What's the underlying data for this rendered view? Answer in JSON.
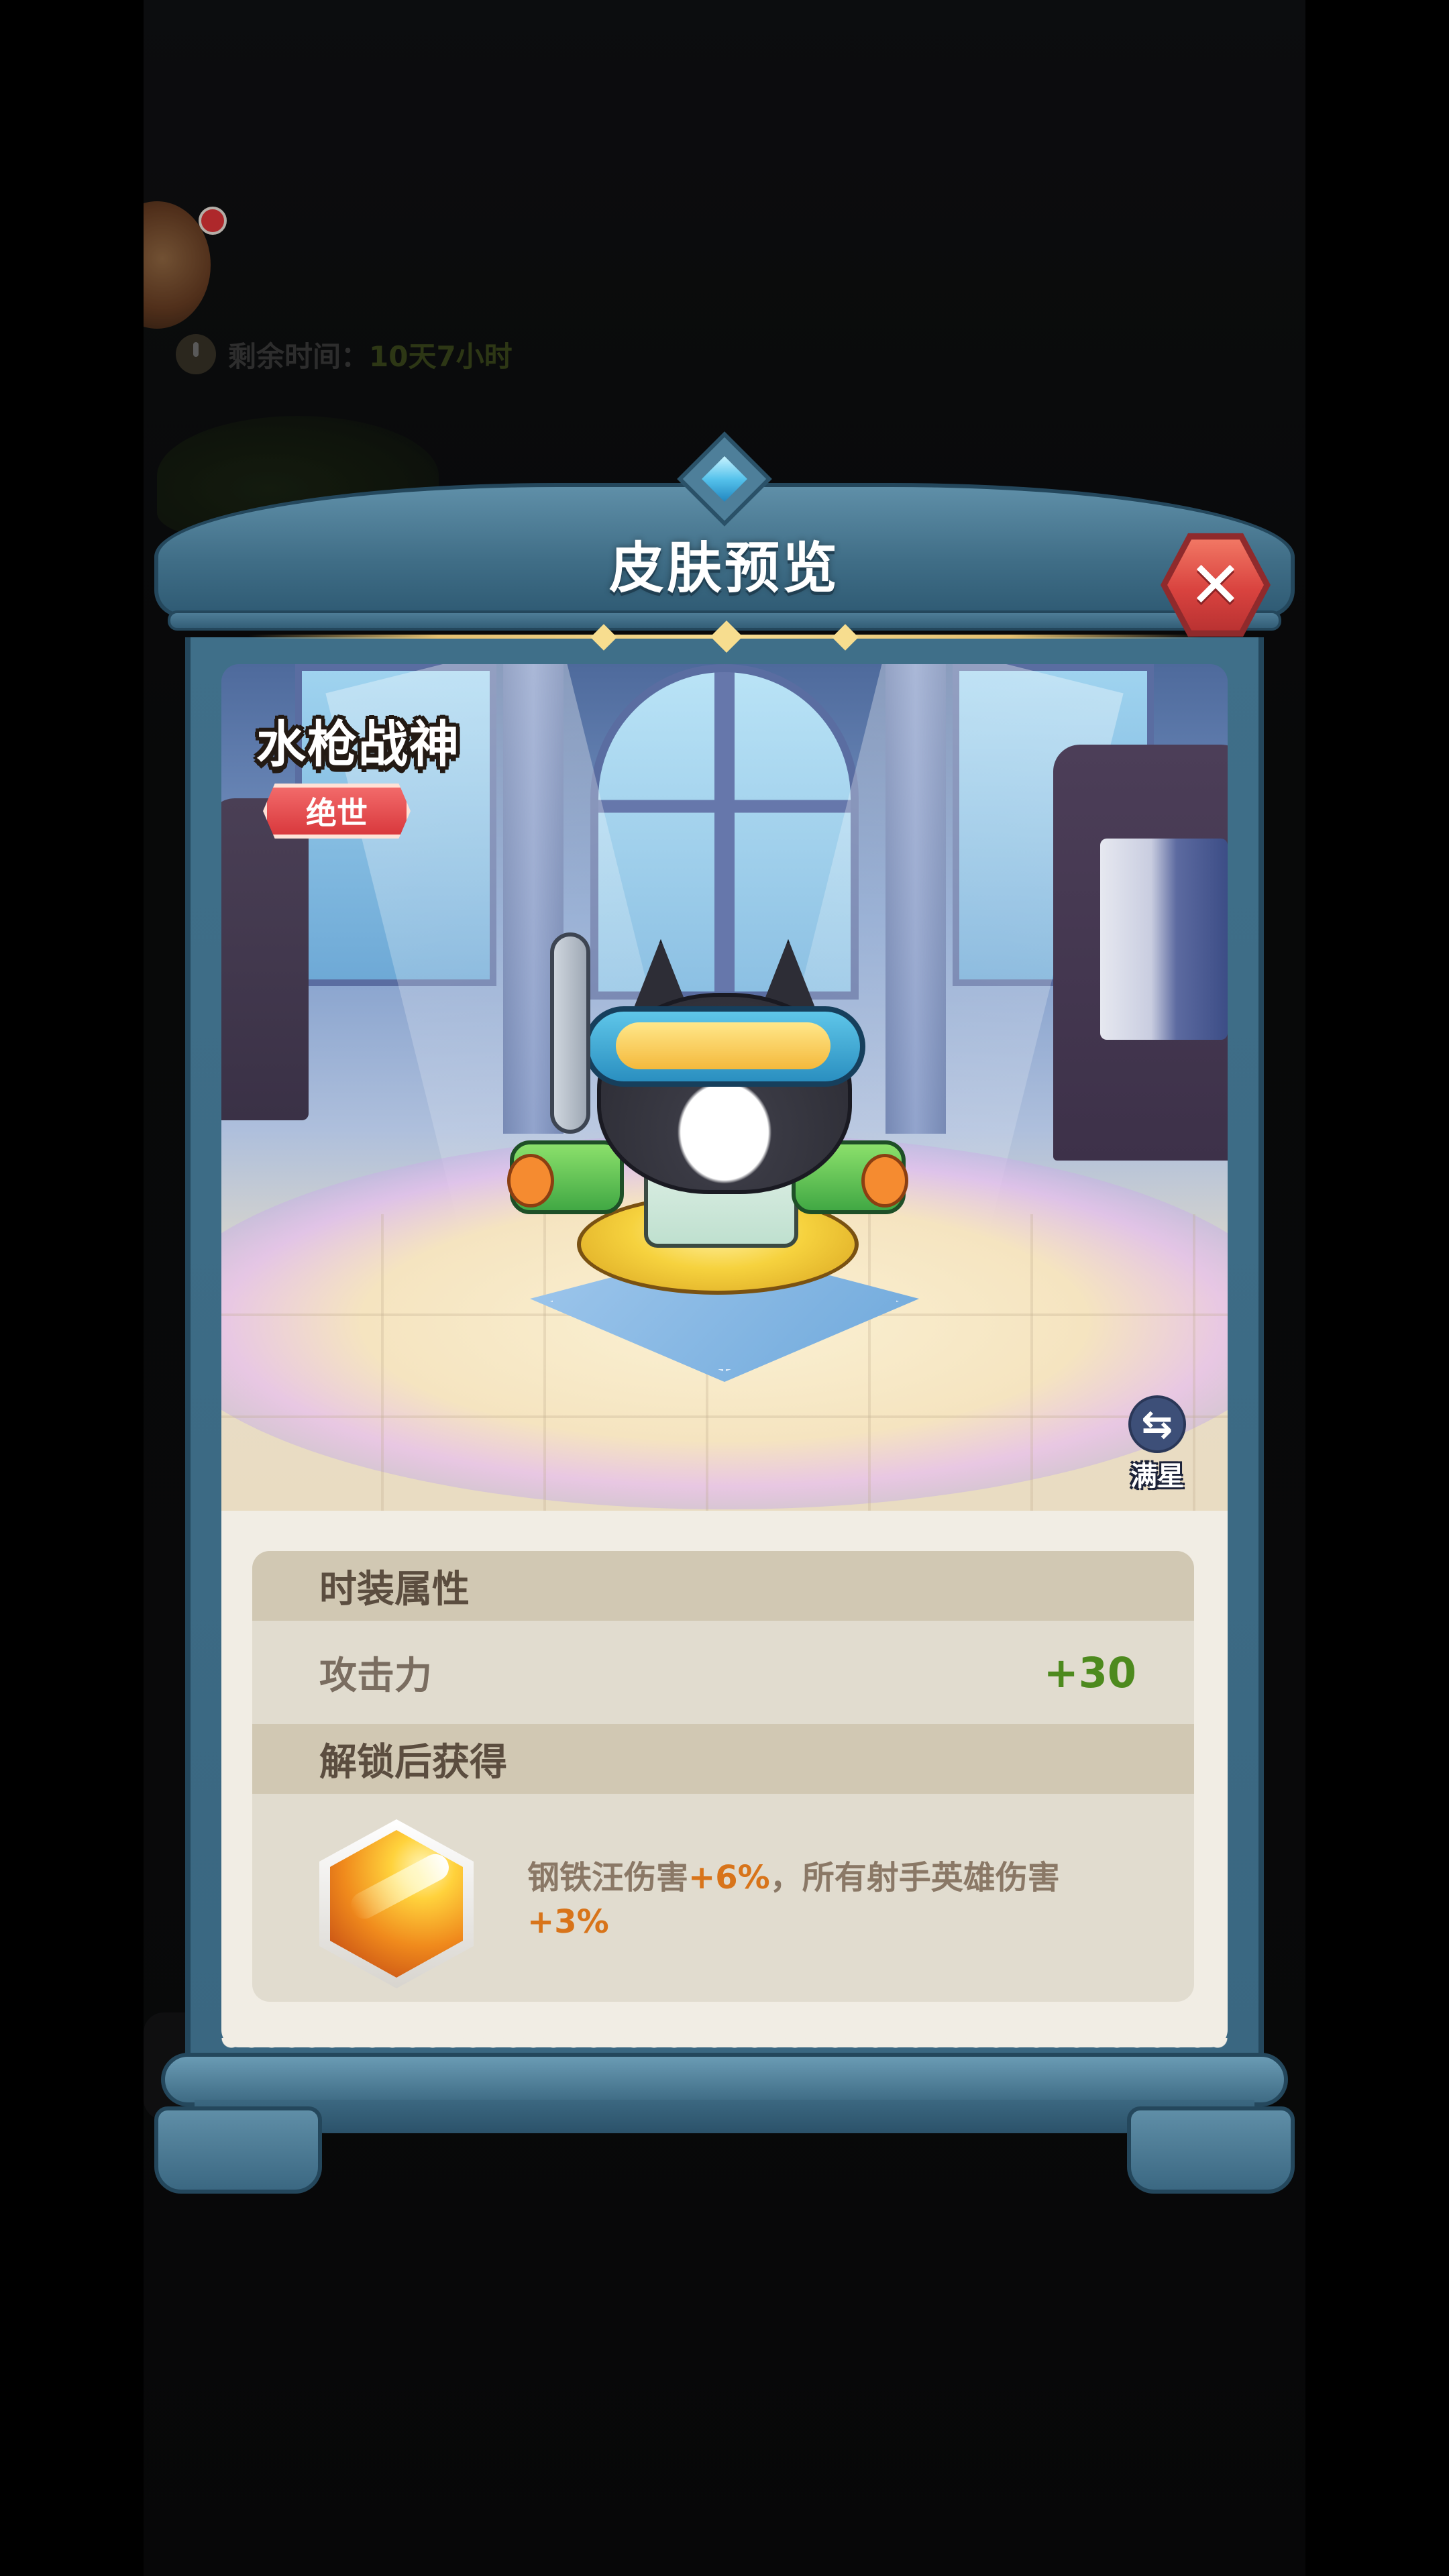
{
  "background": {
    "timer_label": "剩余时间：",
    "timer_value": "10天7小时"
  },
  "dialog": {
    "title": "皮肤预览",
    "close_label": "✕"
  },
  "skin": {
    "name": "水枪战神",
    "rarity": "绝世",
    "max_star_icon": "⇆",
    "max_star_label": "满星"
  },
  "attributes": {
    "section_title": "时装属性",
    "stat_name": "攻击力",
    "stat_value": "+30"
  },
  "unlock": {
    "section_title": "解锁后获得",
    "desc_part1": "钢铁汪伤害",
    "desc_hl1": "+6%",
    "desc_part2": "，所有射手英雄伤害",
    "desc_hl2": "+3%"
  },
  "colors": {
    "frame": "#3f6f89",
    "close_button": "#d9433f",
    "rarity_badge": "#d9393d",
    "stat_value": "#4d8a1e",
    "highlight": "#d8741a"
  },
  "icons": {
    "close": "close-icon",
    "swap": "swap-icon",
    "clock": "clock-icon",
    "skill": "skill-icon"
  }
}
